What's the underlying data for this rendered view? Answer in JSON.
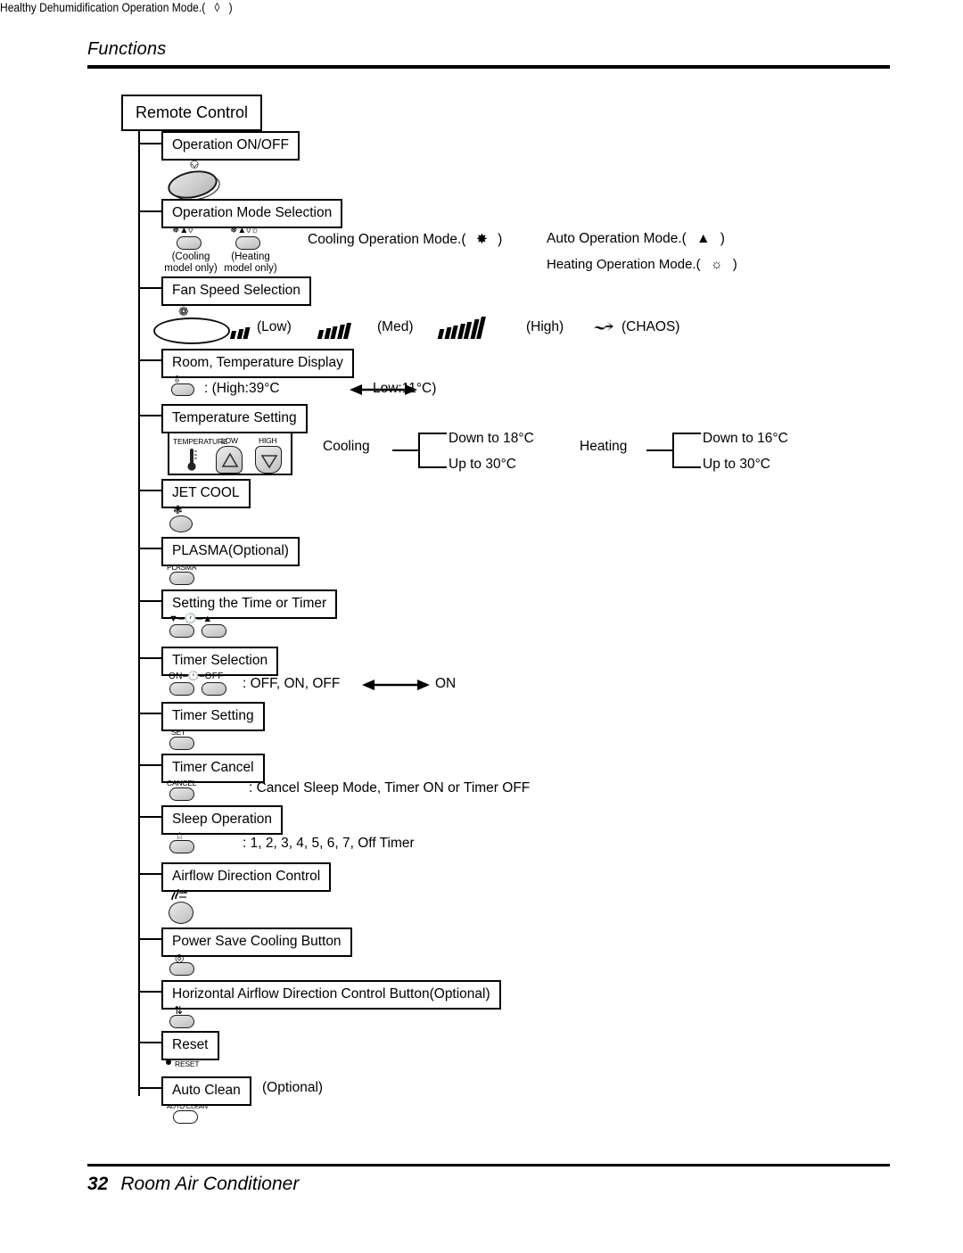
{
  "header": {
    "title": "Functions"
  },
  "footer": {
    "page_number": "32",
    "product": "Room Air Conditioner"
  },
  "tree": {
    "root": "Remote Control",
    "nodes": [
      {
        "label": "Operation ON/OFF"
      },
      {
        "label": "Operation Mode Selection"
      },
      {
        "label": "Fan Speed Selection"
      },
      {
        "label": "Room, Temperature Display"
      },
      {
        "label": "Temperature Setting"
      },
      {
        "label": "JET COOL"
      },
      {
        "label": "PLASMA(Optional)"
      },
      {
        "label": "Setting the Time or Timer"
      },
      {
        "label": "Timer Selection"
      },
      {
        "label": "Timer Setting"
      },
      {
        "label": "Timer Cancel"
      },
      {
        "label": "Sleep Operation"
      },
      {
        "label": "Airflow Direction Control"
      },
      {
        "label": "Power Save Cooling Button"
      },
      {
        "label": "Horizontal Airflow Direction Control Button(Optional)"
      },
      {
        "label": "Reset"
      },
      {
        "label": "Auto Clean"
      }
    ]
  },
  "operation_mode": {
    "cooling_caption_line1": "(Cooling",
    "cooling_caption_line2": "model only)",
    "heating_caption_line1": "(Heating",
    "heating_caption_line2": "model only)",
    "cooling_button_glyphs": "❅▲◊",
    "heating_button_glyphs": "❅▲◊☼",
    "modes": [
      {
        "text": "Cooling Operation Mode.(",
        "symbol": "✸",
        "close": ")"
      },
      {
        "text": "Auto Operation Mode.(",
        "symbol": "▲",
        "close": ")"
      },
      {
        "text": "Healthy Dehumidification Operation Mode.(",
        "symbol": "◊",
        "close": ")"
      },
      {
        "text": "Heating Operation Mode.(",
        "symbol": "☼",
        "close": ")"
      }
    ]
  },
  "fan_speed": {
    "low_label": "(Low)",
    "med_label": "(Med)",
    "high_label": "(High)",
    "chaos_label": "(CHAOS)",
    "low_bars": 3,
    "med_bars": 5,
    "high_bars": 7
  },
  "room_temp_display": {
    "text": ": (High:39°C",
    "text_end": "Low:11°C)"
  },
  "temperature_setting": {
    "panel_label": "TEMPERATURE",
    "low_label": "LOW",
    "high_label": "HIGH",
    "cooling_label": "Cooling",
    "cooling_down": "Down to 18°C",
    "cooling_up": "Up to 30°C",
    "heating_label": "Heating",
    "heating_down": "Down to 16°C",
    "heating_up": "Up to 30°C"
  },
  "plasma": {
    "button_label": "PLASMA"
  },
  "time_timer": {
    "glyph_row": "▼–🕐–▲"
  },
  "timer_selection": {
    "glyph_row": "ON–🕐–OFF",
    "text": ": OFF, ON, OFF",
    "text_end": "ON"
  },
  "timer_setting": {
    "button_label": "SET"
  },
  "timer_cancel": {
    "button_label": "CANCEL",
    "text": ": Cancel Sleep Mode, Timer ON or Timer OFF"
  },
  "sleep_operation": {
    "text": ": 1, 2, 3, 4, 5, 6, 7,  Off Timer"
  },
  "reset": {
    "button_label": "RESET"
  },
  "auto_clean": {
    "button_label": "AUTO CLEAN",
    "optional": "(Optional)"
  }
}
